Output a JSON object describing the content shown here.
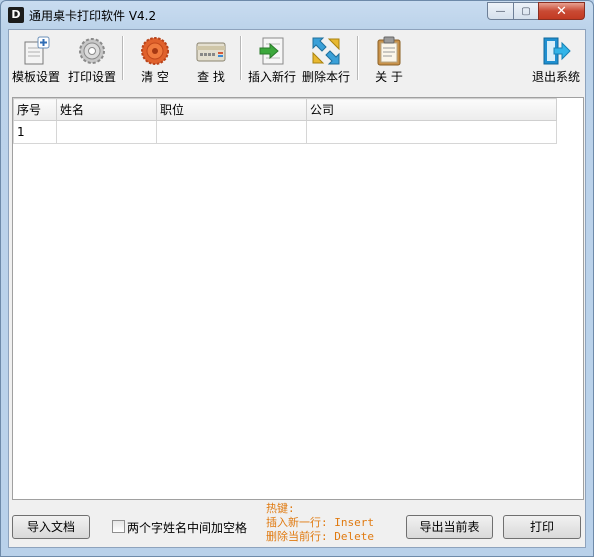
{
  "window": {
    "title": "通用桌卡打印软件    V4.2",
    "app_icon_glyph": "D"
  },
  "controls": {
    "minimize": "—",
    "maximize": "▢",
    "close": "✕"
  },
  "toolbar": {
    "template_settings": "模板设置",
    "print_settings": "打印设置",
    "clear": "清      空",
    "find": "查      找",
    "insert_row": "插入新行",
    "delete_row": "删除本行",
    "about": "关      于",
    "exit": "退出系统"
  },
  "table": {
    "headers": [
      "序号",
      "姓名",
      "职位",
      "公司"
    ],
    "rows": [
      [
        "1",
        "",
        "",
        ""
      ]
    ]
  },
  "bottom": {
    "import_button": "导入文档",
    "space_checkbox_label": "两个字姓名中间加空格",
    "hotkeys_title": "热键:",
    "hotkey_insert": "插入新一行: Insert",
    "hotkey_delete": "删除当前行: Delete",
    "export_button": "导出当前表",
    "print_button": "打印"
  },
  "colors": {
    "hotkey_text": "#e07a10",
    "title_bg": "#b9d1ea",
    "close_button": "#c94a34"
  }
}
